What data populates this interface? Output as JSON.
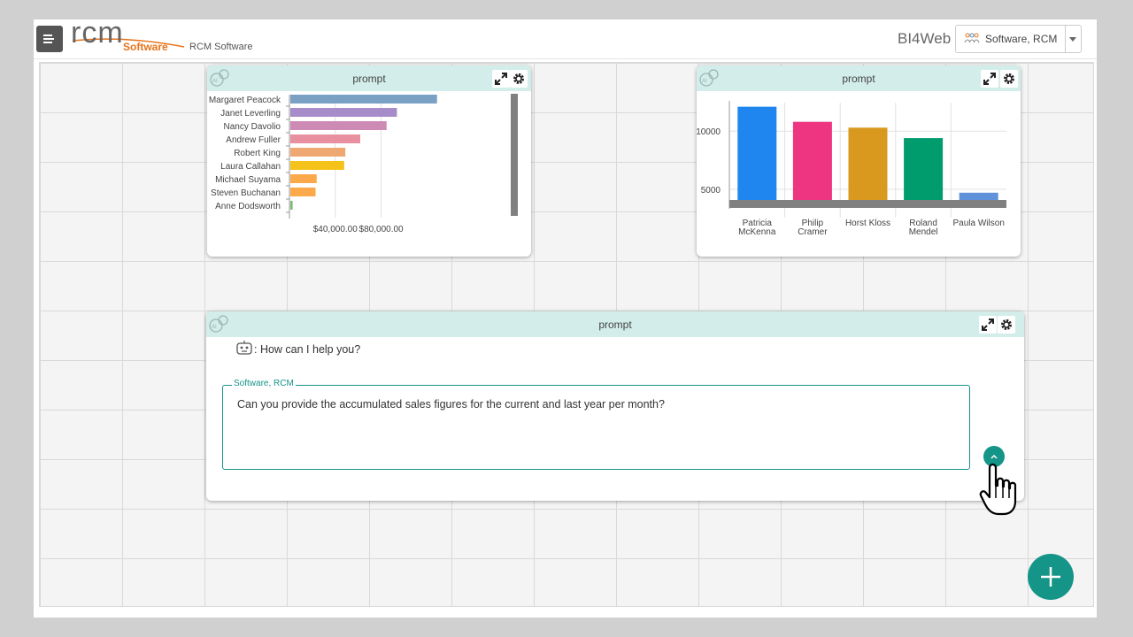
{
  "header": {
    "logo_text": "rcm",
    "logo_sub": "Software",
    "company": "RCM Software",
    "app_title": "BI4Web",
    "user": "Software, RCM"
  },
  "widget1": {
    "title": "prompt",
    "chart_data": {
      "type": "bar",
      "orientation": "horizontal",
      "categories": [
        "Margaret Peacock",
        "Janet Leverling",
        "Nancy Davolio",
        "Andrew Fuller",
        "Robert King",
        "Laura Callahan",
        "Michael Suyama",
        "Steven Buchanan",
        "Anne Dodsworth"
      ],
      "values": [
        128000,
        93000,
        84000,
        61000,
        48000,
        47000,
        23000,
        22000,
        2000
      ],
      "colors": [
        "#7aa0c4",
        "#a68cc8",
        "#cc8ab5",
        "#e8909f",
        "#f0a873",
        "#f5c21a",
        "#fba94a",
        "#fba94a",
        "#7fb876"
      ],
      "xticks": [
        "$40,000.00",
        "$80,000.00"
      ],
      "xtick_values": [
        40000,
        80000
      ],
      "xlim": [
        0,
        190000
      ]
    }
  },
  "widget2": {
    "title": "prompt",
    "chart_data": {
      "type": "bar",
      "categories": [
        "Patricia McKenna",
        "Philip Cramer",
        "Horst Kloss",
        "Roland Mendel",
        "Paula Wilson"
      ],
      "category_lines": [
        [
          "Patricia",
          "McKenna"
        ],
        [
          "Philip",
          "Cramer"
        ],
        [
          "Horst Kloss"
        ],
        [
          "Roland",
          "Mendel"
        ],
        [
          "Paula Wilson"
        ]
      ],
      "values": [
        12100,
        10800,
        10300,
        9400,
        4700
      ],
      "colors": [
        "#2086ef",
        "#ee3581",
        "#d9991f",
        "#009c6e",
        "#5f92d8"
      ],
      "yticks": [
        5000,
        10000
      ],
      "ylim": [
        4000,
        12300
      ]
    }
  },
  "widget3": {
    "title": "prompt",
    "bot_message": ": How can I help you?",
    "input_label": "Software, RCM",
    "input_value": "Can you provide the accumulated sales figures for the current and last year per month?"
  },
  "icons": {
    "menu": "menu-icon",
    "expand": "expand-icon",
    "settings": "gear-icon",
    "ai": "ai-chat-icon",
    "bot": "robot-icon",
    "send": "chevron-up-icon",
    "add": "plus-icon",
    "cursor": "hand-pointer-icon"
  },
  "colors": {
    "accent": "#159488",
    "header_bg": "#d3eeea"
  }
}
